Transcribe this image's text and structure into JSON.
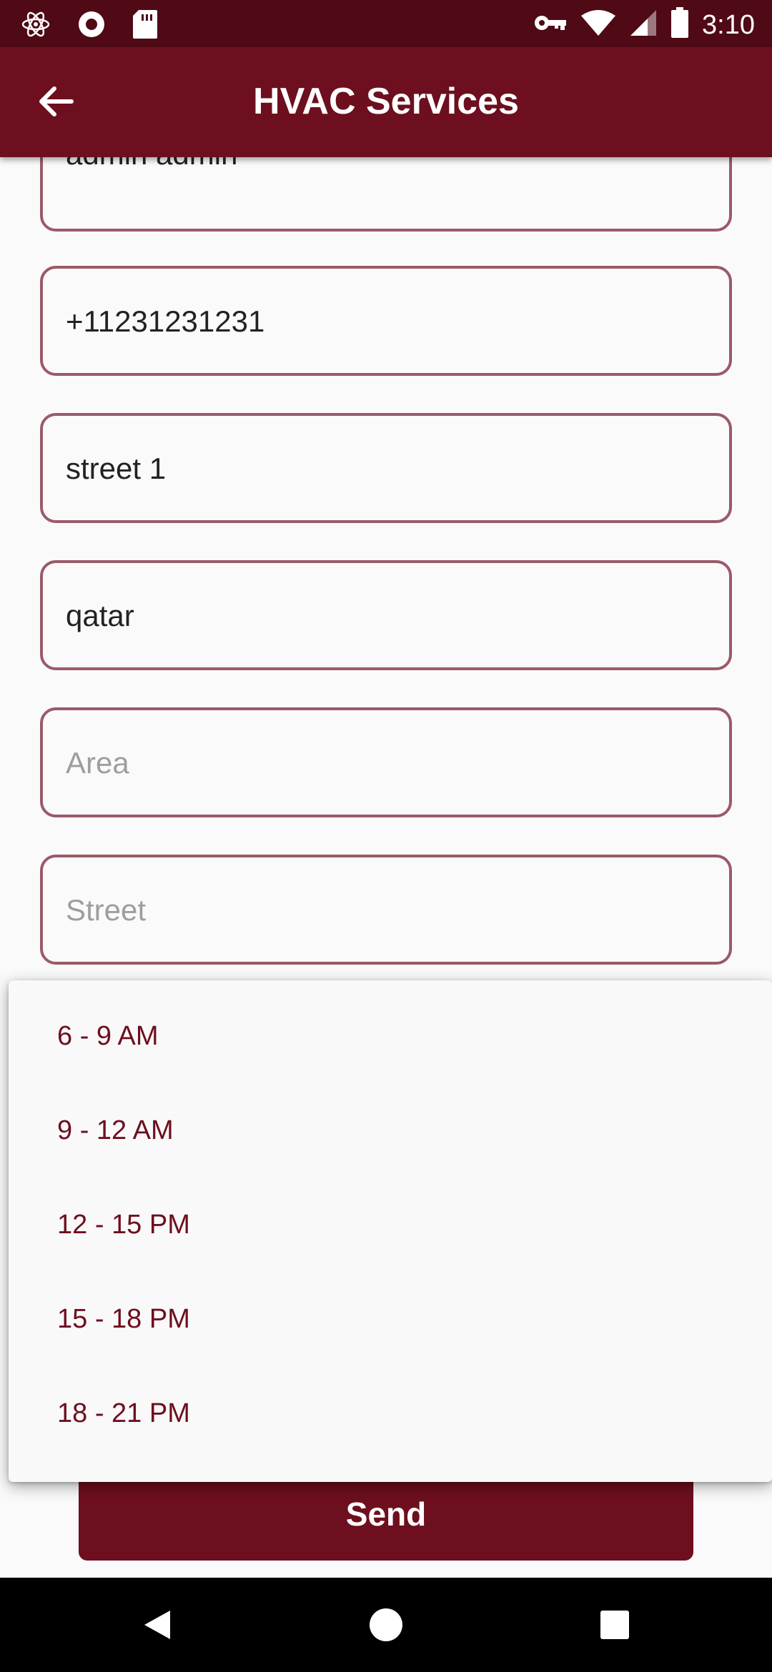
{
  "status_bar": {
    "time": "3:10",
    "icons_left": [
      "atom-icon",
      "record-icon",
      "sd-card-icon"
    ],
    "icons_right": [
      "key-icon",
      "wifi-icon",
      "signal-icon",
      "battery-icon"
    ]
  },
  "app_bar": {
    "title": "HVAC Services",
    "back_icon": "arrow-back-icon"
  },
  "form": {
    "fields": [
      {
        "name": "name",
        "value": "admin admin",
        "placeholder": ""
      },
      {
        "name": "phone",
        "value": "+11231231231",
        "placeholder": ""
      },
      {
        "name": "address",
        "value": "street 1",
        "placeholder": ""
      },
      {
        "name": "country",
        "value": "qatar",
        "placeholder": ""
      },
      {
        "name": "area",
        "value": "",
        "placeholder": "Area"
      },
      {
        "name": "street",
        "value": "",
        "placeholder": "Street"
      }
    ],
    "send_label": "Send"
  },
  "time_menu": {
    "options": [
      "6 - 9 AM",
      "9 - 12 AM",
      "12 - 15 PM",
      "15 - 18 PM",
      "18 - 21 PM"
    ]
  },
  "colors": {
    "primary": "#6d0f1e",
    "status_bar": "#4f0a16",
    "field_border": "#9a5a69"
  },
  "nav_bar": {
    "icons": [
      "back-triangle-icon",
      "home-circle-icon",
      "recents-square-icon"
    ]
  }
}
